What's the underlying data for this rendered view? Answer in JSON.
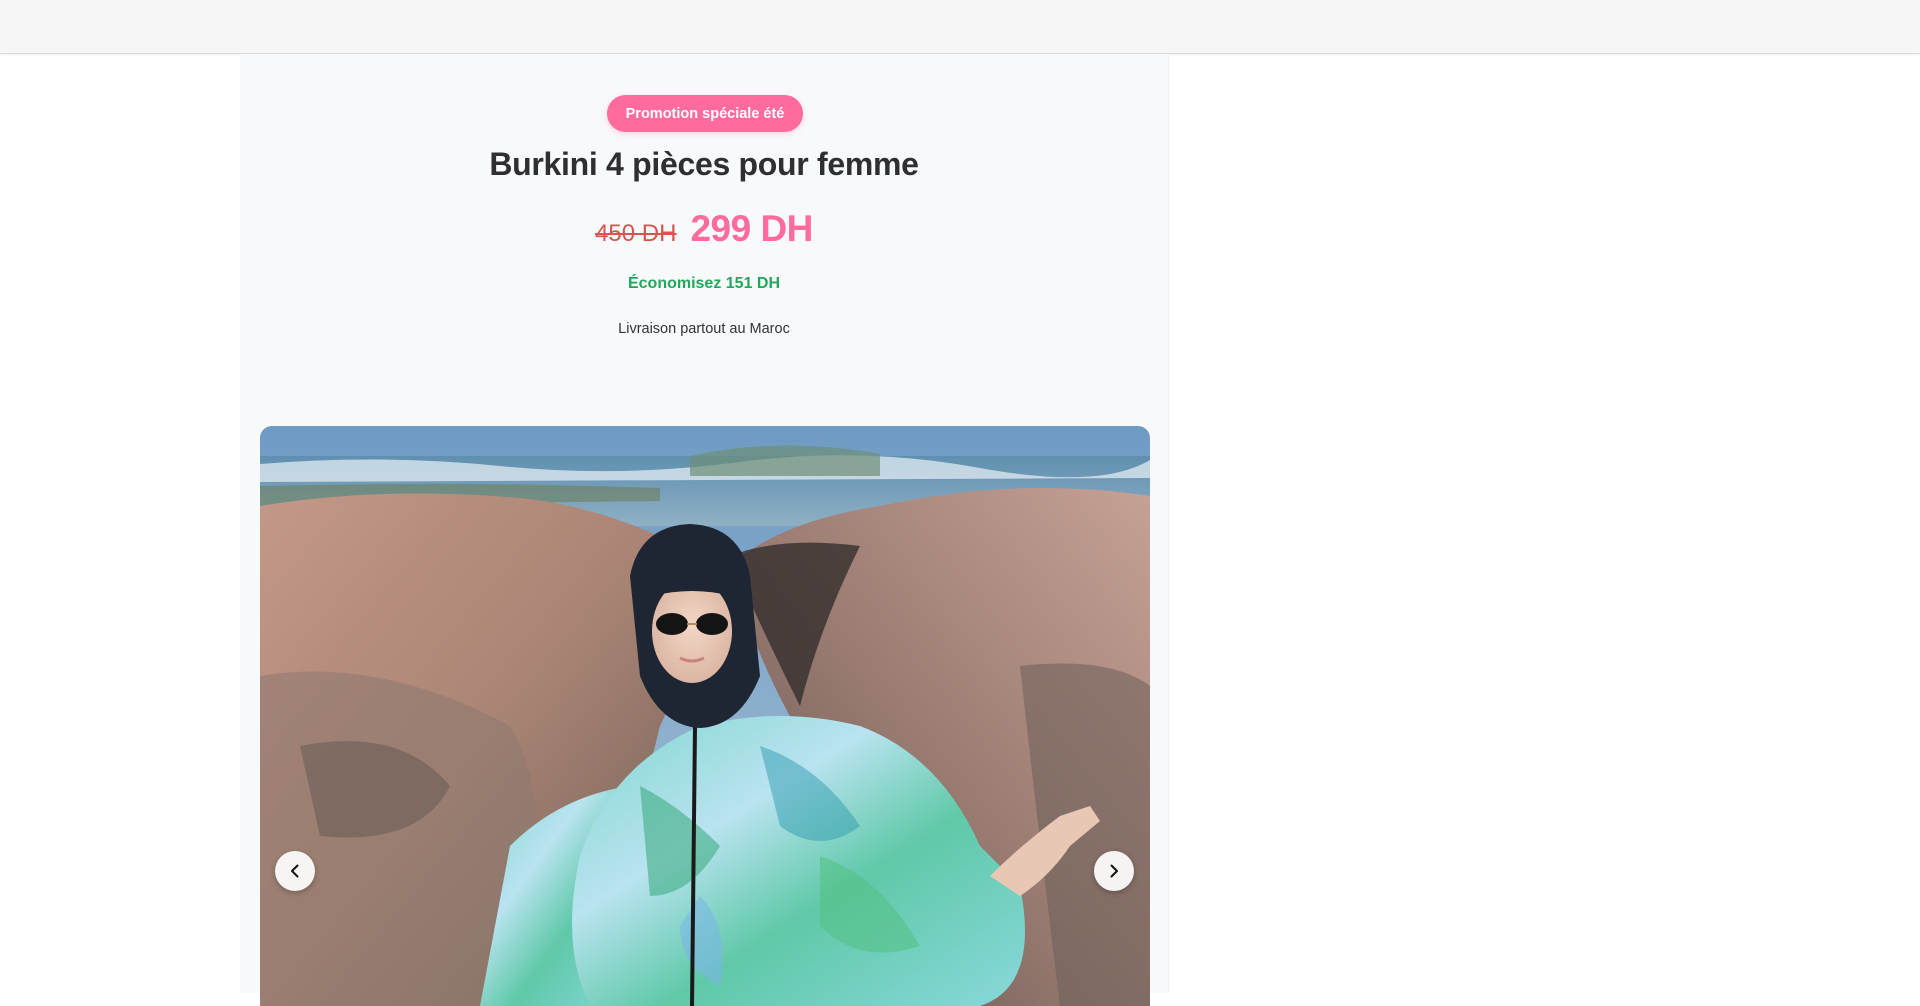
{
  "header": {},
  "product": {
    "badge": "Promotion spéciale été",
    "title": "Burkini 4 pièces pour femme",
    "old_price": "450 DH",
    "new_price": "299 DH",
    "savings": "Économisez 151 DH",
    "delivery": "Livraison partout au Maroc"
  },
  "gallery": {
    "image_alt": "Femme portant un burkini turquoise à motifs sur des rochers au bord de la mer",
    "prev_icon": "chevron-left-icon",
    "next_icon": "chevron-right-icon"
  },
  "colors": {
    "accent_pink": "#ff6b9d",
    "old_price_red": "#d9534f",
    "savings_green": "#22a85a",
    "title_dark": "#2f2f33"
  }
}
